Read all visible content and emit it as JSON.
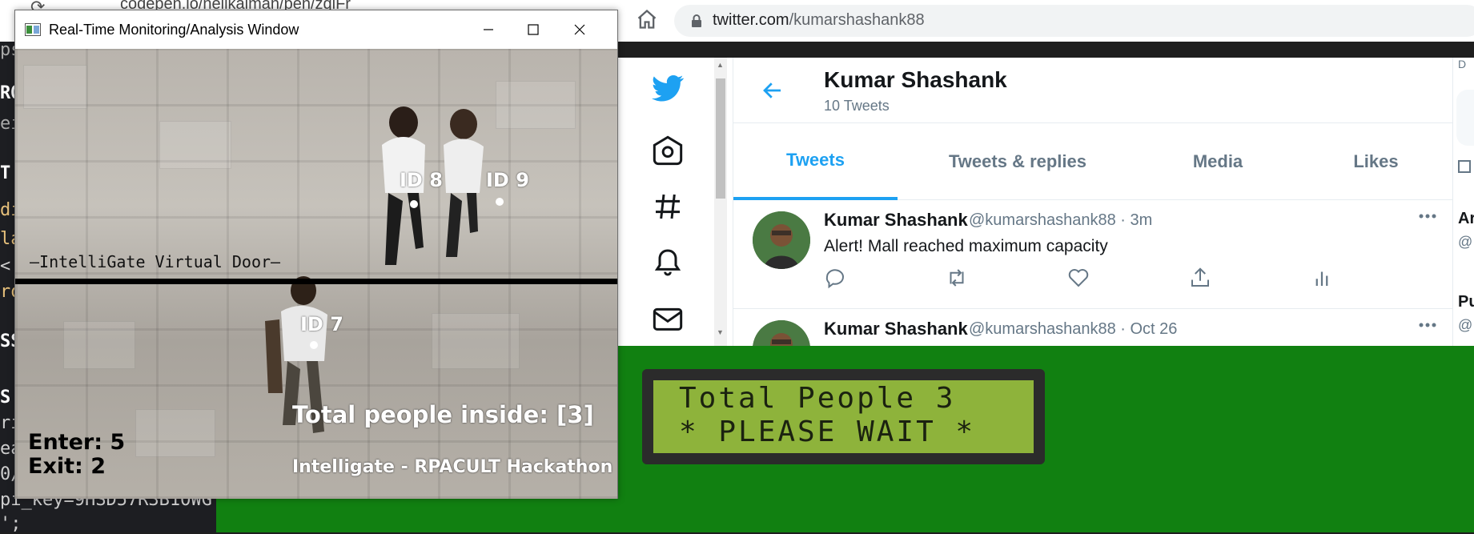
{
  "browser": {
    "previous_url": "codepen.io/neilkalman/pen/zqlFr",
    "url_domain": "twitter.com",
    "url_path": "/kumarshashank88"
  },
  "code_editor": {
    "lines": [
      "ps",
      "RO",
      "ei",
      "T",
      "di",
      "la",
      "<",
      "ro",
      "SS",
      "S",
      "ri",
      "ea",
      "0/",
      "pi_key=9HSD57R3B1OWG",
      "';"
    ]
  },
  "cv_window": {
    "title": "Real-Time Monitoring/Analysis Window",
    "door_label": "—IntelliGate Virtual Door—",
    "ids": [
      "ID 8",
      "ID 9",
      "ID 7"
    ],
    "total_inside": "Total people inside: [3]",
    "hackathon": "Intelligate - RPACULT Hackathon",
    "enter": "Enter: 5",
    "exit": "Exit: 2"
  },
  "twitter": {
    "profile_name": "Kumar Shashank",
    "tweet_count": "10 Tweets",
    "tabs": [
      "Tweets",
      "Tweets & replies",
      "Media",
      "Likes"
    ],
    "active_tab": "Tweets",
    "tweets": [
      {
        "name": "Kumar Shashank",
        "handle": "@kumarshashank88 · 3m",
        "text": "Alert! Mall reached maximum capacity"
      },
      {
        "name": "Kumar Shashank",
        "handle": "@kumarshashank88 · Oct 26",
        "text": ""
      }
    ],
    "right_partial": [
      "Ar",
      "@",
      "Pu",
      "@"
    ],
    "brand_color": "#1da1f2"
  },
  "lcd": {
    "line1": "Total People 3",
    "line2": "* PLEASE WAIT *"
  },
  "colors": {
    "desktop_green": "#118011",
    "lcd_green": "#8eb33b"
  }
}
